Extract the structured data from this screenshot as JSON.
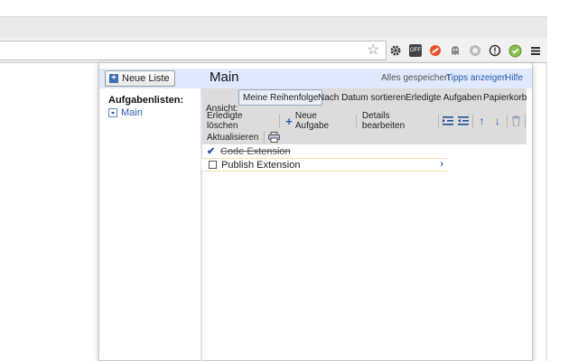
{
  "browser": {
    "toolbar_icons": [
      "star-icon",
      "gear-icon",
      "off-badge-icon",
      "blocked-icon",
      "ghost-icon",
      "shield-icon",
      "info-icon",
      "tasks-check-icon",
      "menu-icon"
    ],
    "off_badge_text": "OFF"
  },
  "header": {
    "new_list_label": "Neue Liste",
    "list_title": "Main",
    "status": "Alles gespeichert",
    "tips_link": "Tipps anzeigen",
    "help_link": "Hilfe"
  },
  "sidebar": {
    "heading": "Aufgabenlisten:",
    "lists": [
      {
        "label": "Main"
      }
    ]
  },
  "toolbar": {
    "view_label": "Ansicht:",
    "views": [
      "Meine Reihenfolge",
      "Nach Datum sortieren",
      "Erledigte Aufgaben",
      "Papierkorb"
    ],
    "active_view": "Meine Reihenfolge",
    "clear_completed": "Erledigte löschen",
    "new_task": "Neue Aufgabe",
    "edit_details": "Details bearbeiten",
    "refresh": "Aktualisieren"
  },
  "tasks": [
    {
      "title": "Code Extension",
      "completed": true
    },
    {
      "title": "Publish Extension",
      "completed": false
    }
  ],
  "colors": {
    "accent": "#2a5db0",
    "header_bg": "#dfe9fb",
    "toolbar_bg": "#dcdcdc"
  }
}
